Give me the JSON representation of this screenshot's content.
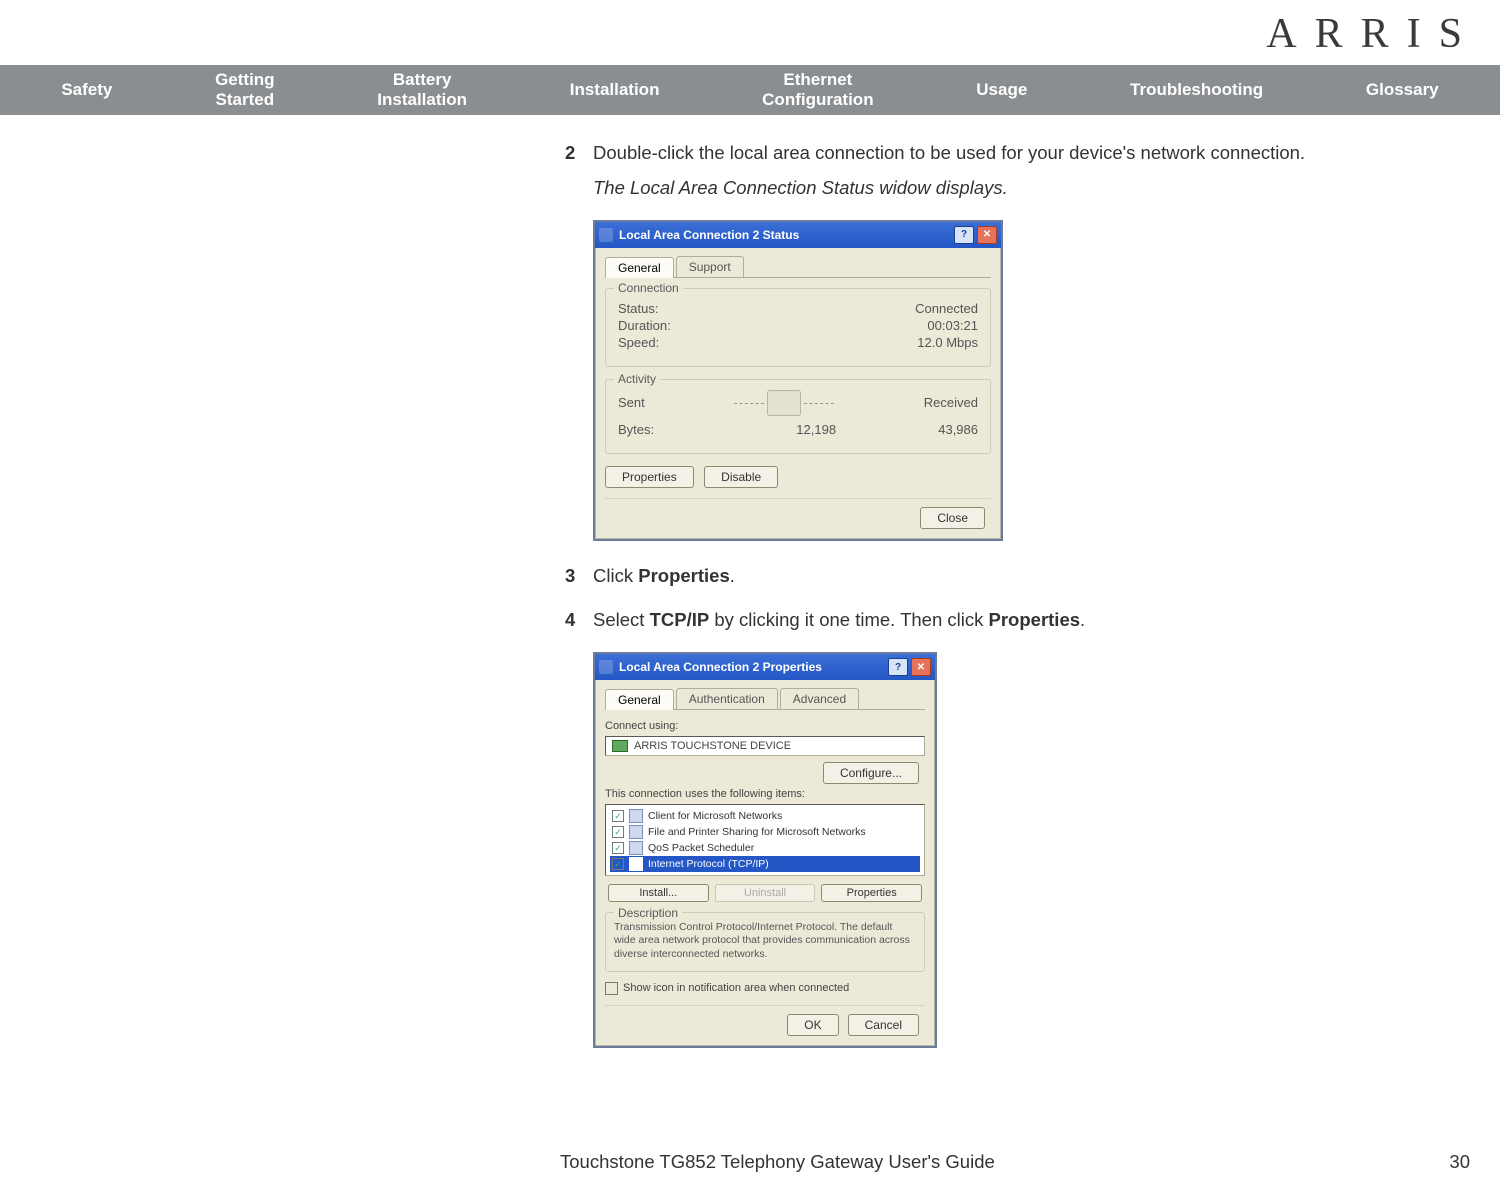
{
  "brand": "ARRIS",
  "nav": {
    "items": [
      "Safety",
      "Getting\nStarted",
      "Battery\nInstallation",
      "Installation",
      "Ethernet\nConfiguration",
      "Usage",
      "Troubleshooting",
      "Glossary"
    ]
  },
  "steps": {
    "s2": {
      "num": "2",
      "text_a": "Double-click the local area connection to be used for your device's network connection.",
      "note": "The Local Area Connection Status widow displays."
    },
    "s3": {
      "num": "3",
      "pre": "Click ",
      "bold": "Properties",
      "post": "."
    },
    "s4": {
      "num": "4",
      "pre": "Select ",
      "bold1": "TCP/IP",
      "mid": " by clicking it one time. Then click ",
      "bold2": "Properties",
      "post": "."
    }
  },
  "dlg_status": {
    "title": "Local Area Connection 2 Status",
    "tabs": {
      "general": "General",
      "support": "Support"
    },
    "conn_group": "Connection",
    "rows": {
      "status_l": "Status:",
      "status_v": "Connected",
      "duration_l": "Duration:",
      "duration_v": "00:03:21",
      "speed_l": "Speed:",
      "speed_v": "12.0 Mbps"
    },
    "activity_group": "Activity",
    "activity": {
      "sent": "Sent",
      "received": "Received",
      "bytes_l": "Bytes:",
      "bytes_sent": "12,198",
      "bytes_recv": "43,986"
    },
    "buttons": {
      "properties": "Properties",
      "disable": "Disable",
      "close": "Close"
    }
  },
  "dlg_props": {
    "title": "Local Area Connection 2 Properties",
    "tabs": {
      "general": "General",
      "auth": "Authentication",
      "adv": "Advanced"
    },
    "connect_using_l": "Connect using:",
    "device": "ARRIS TOUCHSTONE DEVICE",
    "configure": "Configure...",
    "uses_label": "This connection uses the following items:",
    "items": [
      {
        "checked": true,
        "label": "Client for Microsoft Networks"
      },
      {
        "checked": true,
        "label": "File and Printer Sharing for Microsoft Networks"
      },
      {
        "checked": true,
        "label": "QoS Packet Scheduler"
      },
      {
        "checked": true,
        "label": "Internet Protocol (TCP/IP)",
        "selected": true
      }
    ],
    "buttons": {
      "install": "Install...",
      "uninstall": "Uninstall",
      "properties": "Properties"
    },
    "desc_group": "Description",
    "desc_text": "Transmission Control Protocol/Internet Protocol. The default wide area network protocol that provides communication across diverse interconnected networks.",
    "show_icon": "Show icon in notification area when connected",
    "ok": "OK",
    "cancel": "Cancel"
  },
  "footer": {
    "title": "Touchstone TG852 Telephony Gateway User's Guide",
    "page": "30"
  }
}
